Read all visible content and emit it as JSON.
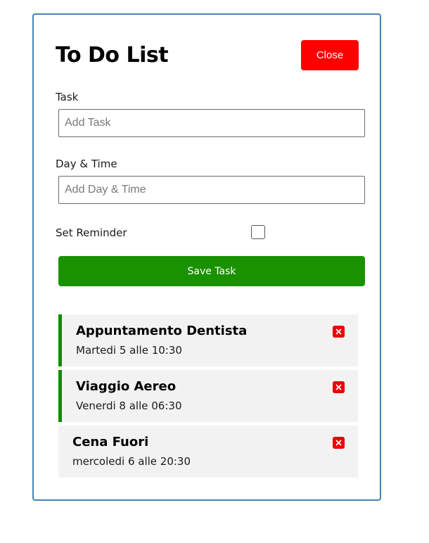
{
  "header": {
    "title": "To Do List",
    "close_label": "Close"
  },
  "form": {
    "task_label": "Task",
    "task_placeholder": "Add Task",
    "task_value": "",
    "datetime_label": "Day & Time",
    "datetime_placeholder": "Add Day & Time",
    "datetime_value": "",
    "reminder_label": "Set Reminder",
    "reminder_checked": false,
    "save_label": "Save Task"
  },
  "tasks": [
    {
      "title": "Appuntamento Dentista",
      "time": "Martedi 5 alle 10:30",
      "reminder": true,
      "delete_icon": "close-icon"
    },
    {
      "title": "Viaggio Aereo",
      "time": "Venerdi 8 alle 06:30",
      "reminder": true,
      "delete_icon": "close-icon"
    },
    {
      "title": "Cena Fuori",
      "time": "mercoledi 6 alle 20:30",
      "reminder": false,
      "delete_icon": "close-icon"
    }
  ],
  "colors": {
    "border": "#4682b4",
    "close_button": "#ff0000",
    "save_button": "#1a9100",
    "reminder_accent": "#118c00",
    "task_background": "#f2f2f2",
    "delete_icon": "#ee0000"
  }
}
